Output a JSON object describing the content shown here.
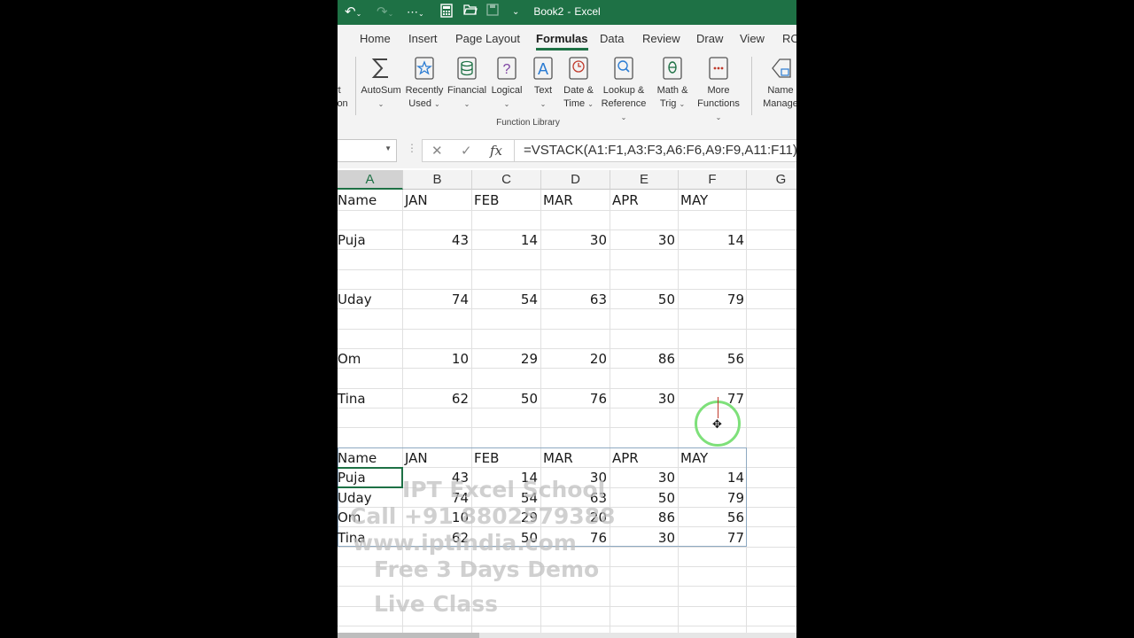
{
  "window": {
    "file_name": "Book2",
    "separator": "-",
    "app_name": "Excel"
  },
  "quick_access": {
    "undo_icon": "undo-icon",
    "redo_icon": "redo-icon",
    "save_icon": "save-icon"
  },
  "tabs": [
    "Home",
    "Insert",
    "Page Layout",
    "Formulas",
    "Data",
    "Review",
    "Draw",
    "View",
    "RC"
  ],
  "active_tab": "Formulas",
  "ribbon": {
    "insert_function_partial": [
      "rt",
      "ion"
    ],
    "buttons": [
      {
        "line1": "AutoSum",
        "line2": "",
        "icon": "sigma-icon"
      },
      {
        "line1": "Recently",
        "line2": "Used",
        "icon": "star-icon"
      },
      {
        "line1": "Financial",
        "line2": "",
        "icon": "coins-icon"
      },
      {
        "line1": "Logical",
        "line2": "",
        "icon": "question-book-icon"
      },
      {
        "line1": "Text",
        "line2": "",
        "icon": "text-a-icon"
      },
      {
        "line1": "Date &",
        "line2": "Time",
        "icon": "clock-book-icon"
      },
      {
        "line1": "Lookup &",
        "line2": "Reference",
        "icon": "magnifier-book-icon"
      },
      {
        "line1": "Math &",
        "line2": "Trig",
        "icon": "theta-book-icon"
      },
      {
        "line1": "More",
        "line2": "Functions",
        "icon": "more-book-icon"
      },
      {
        "line1": "Name",
        "line2": "Manage",
        "icon": "name-tag-icon"
      }
    ],
    "group_label": "Function Library"
  },
  "formula_bar": {
    "name_box": "",
    "cancel_glyph": "✕",
    "enter_glyph": "✓",
    "fx_label": "fx",
    "formula": "=VSTACK(A1:F1,A3:F3,A6:F6,A9:F9,A11:F11)"
  },
  "columns": [
    "A",
    "B",
    "C",
    "D",
    "E",
    "F",
    "G"
  ],
  "source_rows": [
    {
      "name": "Name",
      "values": [
        "JAN",
        "FEB",
        "MAR",
        "APR",
        "MAY"
      ]
    },
    {
      "name": "Puja",
      "values": [
        "43",
        "14",
        "30",
        "30",
        "14"
      ]
    },
    {
      "name": "Uday",
      "values": [
        "74",
        "54",
        "63",
        "50",
        "79"
      ]
    },
    {
      "name": "Om",
      "values": [
        "10",
        "29",
        "20",
        "86",
        "56"
      ]
    },
    {
      "name": "Tina",
      "values": [
        "62",
        "50",
        "76",
        "30",
        "77"
      ]
    }
  ],
  "result_rows": [
    {
      "name": "Name",
      "values": [
        "JAN",
        "FEB",
        "MAR",
        "APR",
        "MAY"
      ]
    },
    {
      "name": "Puja",
      "values": [
        "43",
        "14",
        "30",
        "30",
        "14"
      ]
    },
    {
      "name": "Uday",
      "values": [
        "74",
        "54",
        "63",
        "50",
        "79"
      ]
    },
    {
      "name": "Om",
      "values": [
        "10",
        "29",
        "20",
        "86",
        "56"
      ]
    },
    {
      "name": "Tina",
      "values": [
        "62",
        "50",
        "76",
        "30",
        "77"
      ]
    }
  ],
  "watermark": [
    "IPT Excel School",
    "Call +91 8802579388",
    "www.iptindia.com",
    "Free 3 Days Demo",
    "Live Class"
  ]
}
